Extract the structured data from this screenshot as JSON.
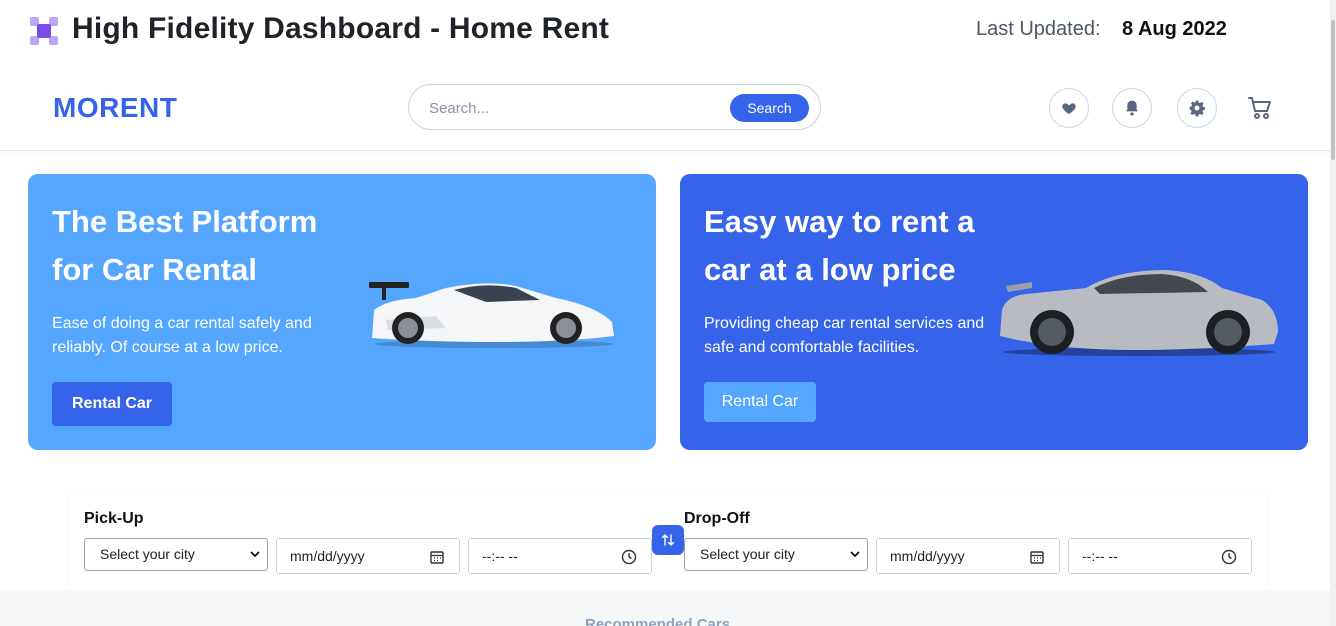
{
  "page": {
    "title": "High Fidelity Dashboard - Home Rent",
    "updated_label": "Last Updated:",
    "updated_date": "8 Aug 2022"
  },
  "navbar": {
    "brand": "MORENT",
    "search_placeholder": "Search...",
    "search_button": "Search",
    "icons": [
      "heart-icon",
      "bell-icon",
      "gear-icon",
      "cart-icon"
    ]
  },
  "hero": [
    {
      "title": "The Best Platform for Car Rental",
      "description": "Ease of doing a car rental safely and reliably. Of course at a low price.",
      "button": "Rental Car",
      "car": "white sports car"
    },
    {
      "title": "Easy way to rent a car at a low price",
      "description": "Providing cheap car rental services and safe and comfortable facilities.",
      "button": "Rental Car",
      "car": "silver sports car"
    }
  ],
  "booking": {
    "pickup": {
      "label": "Pick-Up",
      "city": "Select your city",
      "date": "mm/dd/yyyy",
      "time": "--:-- --"
    },
    "dropoff": {
      "label": "Drop-Off",
      "city": "Select your city",
      "date": "mm/dd/yyyy",
      "time": "--:-- --"
    }
  },
  "section": {
    "recommended_title": "Recommended Cars"
  },
  "colors": {
    "primary": "#3563e9",
    "secondary": "#54a6ff",
    "muted": "#90a3bf"
  }
}
